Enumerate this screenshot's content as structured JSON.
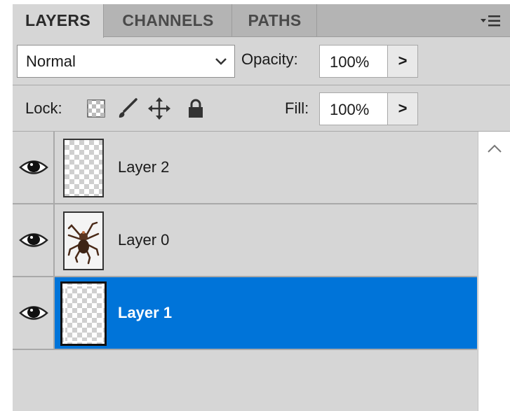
{
  "tabs": [
    {
      "label": "LAYERS",
      "active": true
    },
    {
      "label": "CHANNELS",
      "active": false
    },
    {
      "label": "PATHS",
      "active": false
    }
  ],
  "panel_menu_icon": "panel-menu-icon",
  "blend": {
    "mode": "Normal",
    "icon": "chevron-down-icon"
  },
  "opacity": {
    "label": "Opacity:",
    "value": "100%",
    "button": ">"
  },
  "lock": {
    "label": "Lock:",
    "icons": [
      "lock-transparent-pixels-icon",
      "lock-image-pixels-icon",
      "lock-position-icon",
      "lock-all-icon"
    ]
  },
  "fill": {
    "label": "Fill:",
    "value": "100%",
    "button": ">"
  },
  "layers": [
    {
      "name": "Layer 2",
      "visible": true,
      "selected": false,
      "thumbnail": "transparent"
    },
    {
      "name": "Layer 0",
      "visible": true,
      "selected": false,
      "thumbnail": "spider-image"
    },
    {
      "name": "Layer 1",
      "visible": true,
      "selected": true,
      "thumbnail": "transparent"
    }
  ],
  "colors": {
    "selection": "#0074d9",
    "panel": "#d6d6d6",
    "tab_bar": "#b4b4b4"
  }
}
